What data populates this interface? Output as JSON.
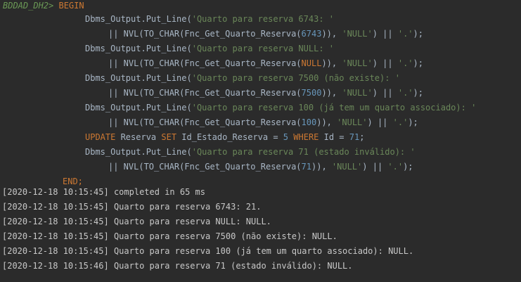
{
  "colors": {
    "background": "#2b2b2b",
    "keyword": "#cc7832",
    "string": "#6a8759",
    "number": "#6897bb",
    "text": "#a9b7c6",
    "prompt": "#6a9955",
    "log_text": "#c8c8c8"
  },
  "editor": {
    "prompt": "BDDAD_DH2>",
    "begin": "BEGIN",
    "end": "END;",
    "lines": [
      {
        "fn": "Dbms_Output.Put_Line(",
        "str": "'Quarto para reserva 6743: '"
      },
      {
        "pre": "|| NVL(TO_CHAR(Fnc_Get_Quarto_Reserva(",
        "arg": "6743",
        "mid": ")), ",
        "null_str": "'NULL'",
        "concat": ") || ",
        "dot_str": "'.'",
        "end": ");"
      },
      {
        "fn": "Dbms_Output.Put_Line(",
        "str": "'Quarto para reserva NULL: '"
      },
      {
        "pre": "|| NVL(TO_CHAR(Fnc_Get_Quarto_Reserva(",
        "arg": "NULL",
        "mid": ")), ",
        "null_str": "'NULL'",
        "concat": ") || ",
        "dot_str": "'.'",
        "end": ");"
      },
      {
        "fn": "Dbms_Output.Put_Line(",
        "str": "'Quarto para reserva 7500 (não existe): '"
      },
      {
        "pre": "|| NVL(TO_CHAR(Fnc_Get_Quarto_Reserva(",
        "arg": "7500",
        "mid": ")), ",
        "null_str": "'NULL'",
        "concat": ") || ",
        "dot_str": "'.'",
        "end": ");"
      },
      {
        "fn": "Dbms_Output.Put_Line(",
        "str": "'Quarto para reserva 100 (já tem um quarto associado): '"
      },
      {
        "pre": "|| NVL(TO_CHAR(Fnc_Get_Quarto_Reserva(",
        "arg": "100",
        "mid": ")), ",
        "null_str": "'NULL'",
        "concat": ") || ",
        "dot_str": "'.'",
        "end": ");"
      },
      {
        "kw1": "UPDATE",
        "t1": " Reserva ",
        "kw2": "SET",
        "t2": " Id_Estado_Reserva = ",
        "n1": "5",
        "t3": " ",
        "kw3": "WHERE",
        "t4": " Id = ",
        "n2": "71",
        "t5": ";"
      },
      {
        "fn": "Dbms_Output.Put_Line(",
        "str": "'Quarto para reserva 71 (estado inválido): '"
      },
      {
        "pre": "|| NVL(TO_CHAR(Fnc_Get_Quarto_Reserva(",
        "arg": "71",
        "mid": ")), ",
        "null_str": "'NULL'",
        "concat": ") || ",
        "dot_str": "'.'",
        "end": ");"
      }
    ]
  },
  "output": [
    "[2020-12-18 10:15:45] completed in 65 ms",
    "[2020-12-18 10:15:45] Quarto para reserva 6743: 21.",
    "[2020-12-18 10:15:45] Quarto para reserva NULL: NULL.",
    "[2020-12-18 10:15:45] Quarto para reserva 7500 (não existe): NULL.",
    "[2020-12-18 10:15:45] Quarto para reserva 100 (já tem um quarto associado): NULL.",
    "[2020-12-18 10:15:46] Quarto para reserva 71 (estado inválido): NULL."
  ]
}
